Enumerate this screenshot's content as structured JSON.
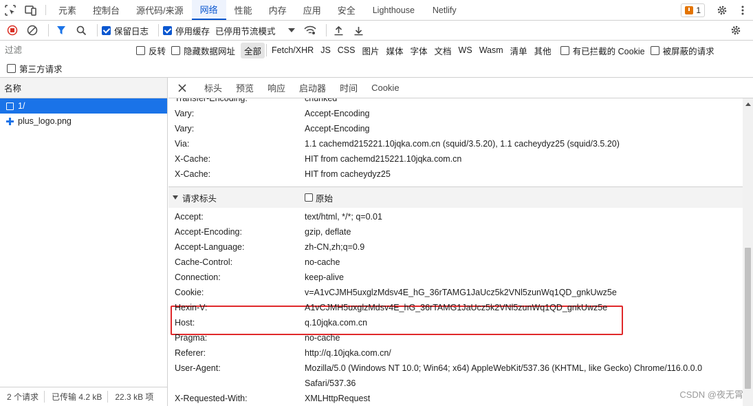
{
  "tabbar": {
    "tabs": [
      {
        "label": "元素",
        "active": false,
        "en": false
      },
      {
        "label": "控制台",
        "active": false,
        "en": false
      },
      {
        "label": "源代码/来源",
        "active": false,
        "en": false
      },
      {
        "label": "网络",
        "active": true,
        "en": false
      },
      {
        "label": "性能",
        "active": false,
        "en": false
      },
      {
        "label": "内存",
        "active": false,
        "en": false
      },
      {
        "label": "应用",
        "active": false,
        "en": false
      },
      {
        "label": "安全",
        "active": false,
        "en": false
      },
      {
        "label": "Lighthouse",
        "active": false,
        "en": true
      },
      {
        "label": "Netlify",
        "active": false,
        "en": true
      }
    ],
    "issue_count": "1"
  },
  "toolbar": {
    "preserve_log_label": "保留日志",
    "disable_cache_label": "停用缓存",
    "throttle_label": "已停用节流模式"
  },
  "filter": {
    "placeholder": "过滤",
    "invert_label": "反转",
    "hide_data_urls_label": "隐藏数据网址",
    "types": [
      "全部",
      "Fetch/XHR",
      "JS",
      "CSS",
      "图片",
      "媒体",
      "字体",
      "文档",
      "WS",
      "Wasm",
      "清单",
      "其他"
    ],
    "blocked_cookies_label": "有已拦截的 Cookie",
    "blocked_requests_label": "被屏蔽的请求",
    "third_party_label": "第三方请求"
  },
  "request_list": {
    "header": "名称",
    "items": [
      {
        "name": "1/",
        "kind": "doc",
        "selected": true
      },
      {
        "name": "plus_logo.png",
        "kind": "img",
        "selected": false
      }
    ],
    "footer": {
      "requests": "2 个请求",
      "transferred": "已传输 4.2 kB",
      "resources": "22.3 kB 项"
    }
  },
  "detail_tabs": [
    "标头",
    "预览",
    "响应",
    "启动器",
    "时间",
    "Cookie"
  ],
  "response_headers": [
    {
      "name": "Transfer-Encoding:",
      "value": "chunked"
    },
    {
      "name": "Vary:",
      "value": "Accept-Encoding"
    },
    {
      "name": "Vary:",
      "value": "Accept-Encoding"
    },
    {
      "name": "Via:",
      "value": "1.1 cachemd215221.10jqka.com.cn (squid/3.5.20), 1.1 cacheydyz25 (squid/3.5.20)"
    },
    {
      "name": "X-Cache:",
      "value": "HIT from cachemd215221.10jqka.com.cn"
    },
    {
      "name": "X-Cache:",
      "value": "HIT from cacheydyz25"
    }
  ],
  "request_section": {
    "title": "请求标头",
    "raw_label": "原始"
  },
  "request_headers": [
    {
      "name": "Accept:",
      "value": "text/html, */*; q=0.01"
    },
    {
      "name": "Accept-Encoding:",
      "value": "gzip, deflate"
    },
    {
      "name": "Accept-Language:",
      "value": "zh-CN,zh;q=0.9"
    },
    {
      "name": "Cache-Control:",
      "value": "no-cache"
    },
    {
      "name": "Connection:",
      "value": "keep-alive"
    },
    {
      "name": "Cookie:",
      "value": "v=A1vCJMH5uxglzMdsv4E_hG_36rTAMG1JaUcz5k2VNl5zunWq1QD_gnkUwz5e"
    },
    {
      "name": "Hexin-V:",
      "value": "A1vCJMH5uxglzMdsv4E_hG_36rTAMG1JaUcz5k2VNl5zunWq1QD_gnkUwz5e"
    },
    {
      "name": "Host:",
      "value": "q.10jqka.com.cn"
    },
    {
      "name": "Pragma:",
      "value": "no-cache"
    },
    {
      "name": "Referer:",
      "value": "http://q.10jqka.com.cn/"
    },
    {
      "name": "User-Agent:",
      "value": "Mozilla/5.0 (Windows NT 10.0; Win64; x64) AppleWebKit/537.36 (KHTML, like Gecko) Chrome/116.0.0.0",
      "value2": "Safari/537.36"
    },
    {
      "name": "X-Requested-With:",
      "value": "XMLHttpRequest"
    }
  ],
  "watermark": "CSDN @夜无霄",
  "colors": {
    "accent": "#0b57d0",
    "selected_row": "#1a73e8",
    "highlight_box": "#e0292b",
    "record_stop": "#d93025"
  }
}
